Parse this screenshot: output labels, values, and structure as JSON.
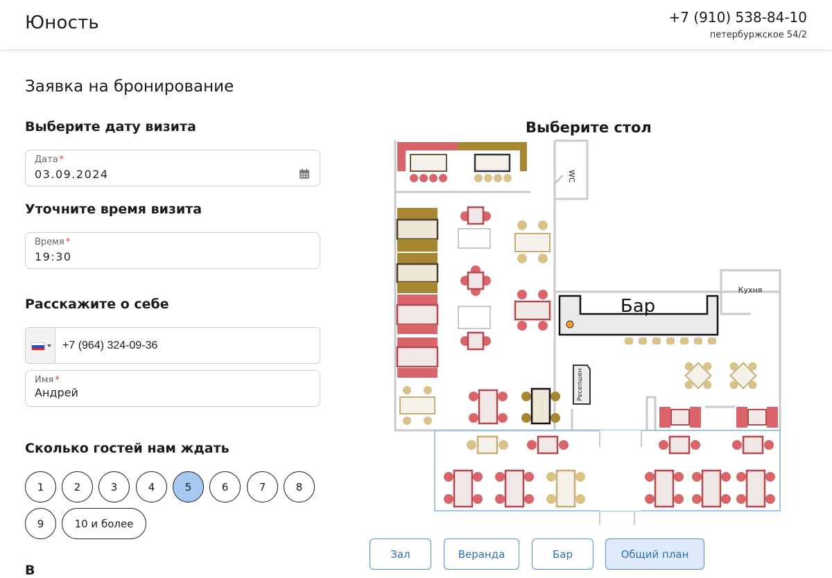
{
  "header": {
    "brand": "Юность",
    "phone": "+7 (910) 538-84-10",
    "address": "петербуржское 54/2"
  },
  "page_title": "Заявка на бронирование",
  "date_section": {
    "title": "Выберите дату визита",
    "label": "Дата",
    "value": "03.09.2024"
  },
  "time_section": {
    "title": "Уточните время визита",
    "label": "Время",
    "value": "19:30"
  },
  "about_section": {
    "title": "Расскажите о себе",
    "phone_value": "+7 (964) 324-09-36",
    "name_label": "Имя",
    "name_value": "Андрей"
  },
  "required_mark": "*",
  "guests_section": {
    "title": "Сколько гостей нам ждать",
    "options": [
      "1",
      "2",
      "3",
      "4",
      "5",
      "6",
      "7",
      "8",
      "9"
    ],
    "more_option": "10 и более",
    "selected": "5"
  },
  "next_section_partial": "В",
  "floor_plan": {
    "title": "Выберите стол",
    "bar_label": "Бар",
    "kitchen_label": "Кухня",
    "wc_label": "WC",
    "reception_label": "Ресепшен"
  },
  "plan_tabs": [
    {
      "label": "Зал",
      "active": false
    },
    {
      "label": "Веранда",
      "active": false
    },
    {
      "label": "Бар",
      "active": false
    },
    {
      "label": "Общий план",
      "active": true
    }
  ],
  "colors": {
    "selected_guest": "#a7c8f2",
    "tab_border": "#4a90d9",
    "table_red": "#d9656b",
    "table_gold": "#a78632",
    "table_beige": "#d9c28a",
    "veranda_border": "#9cc4ea"
  }
}
